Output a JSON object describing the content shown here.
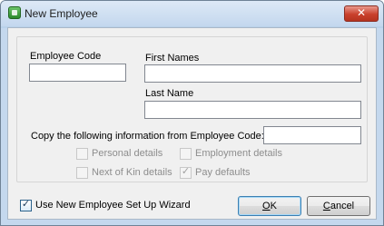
{
  "window": {
    "title": "New Employee",
    "close_glyph": "✕"
  },
  "icons": {
    "app": "app-icon",
    "close": "close-icon"
  },
  "fields": {
    "employee_code": {
      "label": "Employee Code",
      "value": ""
    },
    "first_names": {
      "label": "First Names",
      "value": ""
    },
    "last_name": {
      "label": "Last Name",
      "value": ""
    },
    "copy_from": {
      "label": "Copy the following information from Employee Code:",
      "value": ""
    }
  },
  "copy_options": {
    "personal_details": {
      "label": "Personal details",
      "checked": false
    },
    "employment_details": {
      "label": "Employment details",
      "checked": false
    },
    "next_of_kin_details": {
      "label": "Next of Kin details",
      "checked": false
    },
    "pay_defaults": {
      "label": "Pay defaults",
      "checked": true
    }
  },
  "wizard": {
    "label": "Use New Employee Set Up Wizard",
    "checked": true
  },
  "buttons": {
    "ok": {
      "hotkey": "O",
      "rest": "K"
    },
    "cancel": {
      "hotkey": "C",
      "rest": "ancel"
    }
  },
  "colors": {
    "close_button": "#c9402c",
    "titlebar": "#c3d7ee",
    "client": "#f0f0f0"
  }
}
